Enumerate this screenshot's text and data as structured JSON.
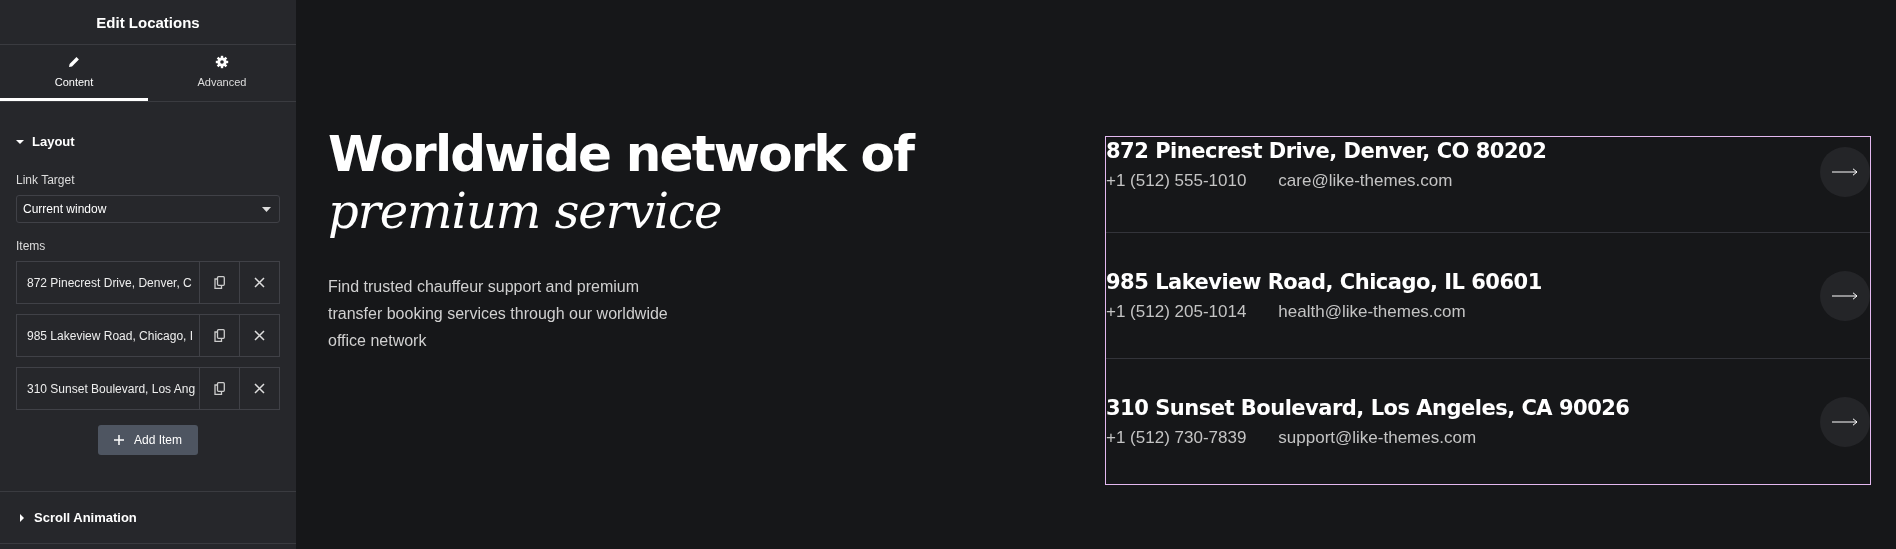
{
  "panel": {
    "title": "Edit Locations",
    "tabs": [
      {
        "label": "Content",
        "selected": true
      },
      {
        "label": "Advanced",
        "selected": false
      }
    ],
    "sections": [
      {
        "title": "Layout",
        "expanded": true,
        "link_target_label": "Link Target",
        "link_target_value": "Current window",
        "items_label": "Items",
        "items": [
          {
            "label": "872 Pinecrest Drive, Denver, C"
          },
          {
            "label": "985 Lakeview Road, Chicago, I"
          },
          {
            "label": "310 Sunset Boulevard, Los Ang"
          }
        ],
        "add_button": "Add Item"
      },
      {
        "title": "Scroll Animation",
        "expanded": false
      }
    ]
  },
  "hero": {
    "heading": "Worldwide network of",
    "heading_italic": "premium service",
    "description": "Find trusted chauffeur support and premium transfer booking services through our worldwide office network"
  },
  "locations": [
    {
      "address": "872 Pinecrest Drive, Denver, CO 80202",
      "phone": "+1 (512) 555-1010",
      "email": "care@like-themes.com"
    },
    {
      "address": "985 Lakeview Road, Chicago, IL 60601",
      "phone": "+1 (512) 205-1014",
      "email": "health@like-themes.com"
    },
    {
      "address": "310 Sunset Boulevard, Los Angeles, CA 90026",
      "phone": "+1 (512) 730-7839",
      "email": "support@like-themes.com"
    }
  ]
}
